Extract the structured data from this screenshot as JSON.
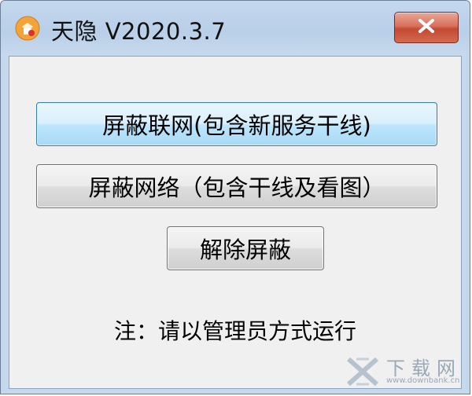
{
  "window": {
    "title": "天隐 V2020.3.7",
    "app_icon": "shield-lock-icon",
    "close_icon": "close-icon"
  },
  "buttons": {
    "block_network_label": "屏蔽联网(包含新服务干线)",
    "block_net_label": "屏蔽网络（包含干线及看图）",
    "unblock_label": "解除屏蔽"
  },
  "note": "注：请以管理员方式运行",
  "watermark": {
    "name": "下载网",
    "url": "www.downbank.cn"
  },
  "colors": {
    "titlebar": "#c4d8ee",
    "close_button": "#c24a34",
    "focused_button_border": "#3c7fb1"
  }
}
